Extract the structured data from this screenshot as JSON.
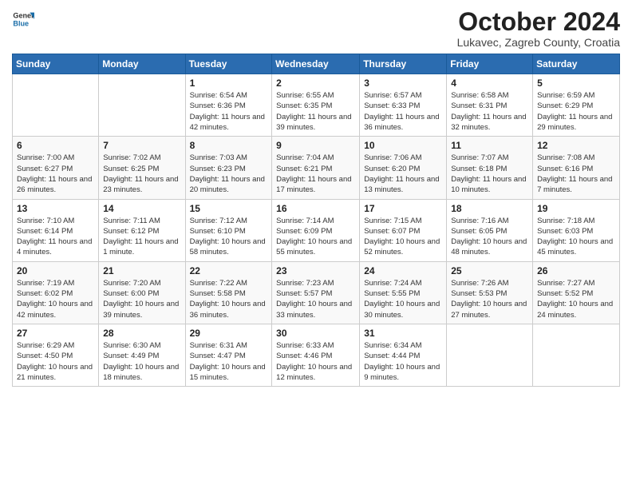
{
  "header": {
    "logo_general": "General",
    "logo_blue": "Blue",
    "title": "October 2024",
    "subtitle": "Lukavec, Zagreb County, Croatia"
  },
  "days_of_week": [
    "Sunday",
    "Monday",
    "Tuesday",
    "Wednesday",
    "Thursday",
    "Friday",
    "Saturday"
  ],
  "weeks": [
    [
      {
        "day": "",
        "info": ""
      },
      {
        "day": "",
        "info": ""
      },
      {
        "day": "1",
        "info": "Sunrise: 6:54 AM\nSunset: 6:36 PM\nDaylight: 11 hours and 42 minutes."
      },
      {
        "day": "2",
        "info": "Sunrise: 6:55 AM\nSunset: 6:35 PM\nDaylight: 11 hours and 39 minutes."
      },
      {
        "day": "3",
        "info": "Sunrise: 6:57 AM\nSunset: 6:33 PM\nDaylight: 11 hours and 36 minutes."
      },
      {
        "day": "4",
        "info": "Sunrise: 6:58 AM\nSunset: 6:31 PM\nDaylight: 11 hours and 32 minutes."
      },
      {
        "day": "5",
        "info": "Sunrise: 6:59 AM\nSunset: 6:29 PM\nDaylight: 11 hours and 29 minutes."
      }
    ],
    [
      {
        "day": "6",
        "info": "Sunrise: 7:00 AM\nSunset: 6:27 PM\nDaylight: 11 hours and 26 minutes."
      },
      {
        "day": "7",
        "info": "Sunrise: 7:02 AM\nSunset: 6:25 PM\nDaylight: 11 hours and 23 minutes."
      },
      {
        "day": "8",
        "info": "Sunrise: 7:03 AM\nSunset: 6:23 PM\nDaylight: 11 hours and 20 minutes."
      },
      {
        "day": "9",
        "info": "Sunrise: 7:04 AM\nSunset: 6:21 PM\nDaylight: 11 hours and 17 minutes."
      },
      {
        "day": "10",
        "info": "Sunrise: 7:06 AM\nSunset: 6:20 PM\nDaylight: 11 hours and 13 minutes."
      },
      {
        "day": "11",
        "info": "Sunrise: 7:07 AM\nSunset: 6:18 PM\nDaylight: 11 hours and 10 minutes."
      },
      {
        "day": "12",
        "info": "Sunrise: 7:08 AM\nSunset: 6:16 PM\nDaylight: 11 hours and 7 minutes."
      }
    ],
    [
      {
        "day": "13",
        "info": "Sunrise: 7:10 AM\nSunset: 6:14 PM\nDaylight: 11 hours and 4 minutes."
      },
      {
        "day": "14",
        "info": "Sunrise: 7:11 AM\nSunset: 6:12 PM\nDaylight: 11 hours and 1 minute."
      },
      {
        "day": "15",
        "info": "Sunrise: 7:12 AM\nSunset: 6:10 PM\nDaylight: 10 hours and 58 minutes."
      },
      {
        "day": "16",
        "info": "Sunrise: 7:14 AM\nSunset: 6:09 PM\nDaylight: 10 hours and 55 minutes."
      },
      {
        "day": "17",
        "info": "Sunrise: 7:15 AM\nSunset: 6:07 PM\nDaylight: 10 hours and 52 minutes."
      },
      {
        "day": "18",
        "info": "Sunrise: 7:16 AM\nSunset: 6:05 PM\nDaylight: 10 hours and 48 minutes."
      },
      {
        "day": "19",
        "info": "Sunrise: 7:18 AM\nSunset: 6:03 PM\nDaylight: 10 hours and 45 minutes."
      }
    ],
    [
      {
        "day": "20",
        "info": "Sunrise: 7:19 AM\nSunset: 6:02 PM\nDaylight: 10 hours and 42 minutes."
      },
      {
        "day": "21",
        "info": "Sunrise: 7:20 AM\nSunset: 6:00 PM\nDaylight: 10 hours and 39 minutes."
      },
      {
        "day": "22",
        "info": "Sunrise: 7:22 AM\nSunset: 5:58 PM\nDaylight: 10 hours and 36 minutes."
      },
      {
        "day": "23",
        "info": "Sunrise: 7:23 AM\nSunset: 5:57 PM\nDaylight: 10 hours and 33 minutes."
      },
      {
        "day": "24",
        "info": "Sunrise: 7:24 AM\nSunset: 5:55 PM\nDaylight: 10 hours and 30 minutes."
      },
      {
        "day": "25",
        "info": "Sunrise: 7:26 AM\nSunset: 5:53 PM\nDaylight: 10 hours and 27 minutes."
      },
      {
        "day": "26",
        "info": "Sunrise: 7:27 AM\nSunset: 5:52 PM\nDaylight: 10 hours and 24 minutes."
      }
    ],
    [
      {
        "day": "27",
        "info": "Sunrise: 6:29 AM\nSunset: 4:50 PM\nDaylight: 10 hours and 21 minutes."
      },
      {
        "day": "28",
        "info": "Sunrise: 6:30 AM\nSunset: 4:49 PM\nDaylight: 10 hours and 18 minutes."
      },
      {
        "day": "29",
        "info": "Sunrise: 6:31 AM\nSunset: 4:47 PM\nDaylight: 10 hours and 15 minutes."
      },
      {
        "day": "30",
        "info": "Sunrise: 6:33 AM\nSunset: 4:46 PM\nDaylight: 10 hours and 12 minutes."
      },
      {
        "day": "31",
        "info": "Sunrise: 6:34 AM\nSunset: 4:44 PM\nDaylight: 10 hours and 9 minutes."
      },
      {
        "day": "",
        "info": ""
      },
      {
        "day": "",
        "info": ""
      }
    ]
  ]
}
